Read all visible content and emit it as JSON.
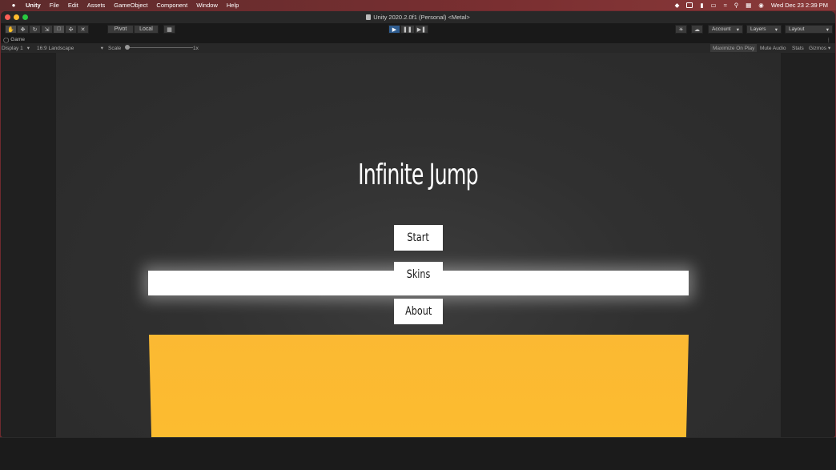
{
  "menubar": {
    "apple": "",
    "items": [
      "Unity",
      "File",
      "Edit",
      "Assets",
      "GameObject",
      "Component",
      "Window",
      "Help"
    ],
    "datetime": "Wed Dec 23  2:39 PM"
  },
  "window": {
    "title": "Unity 2020.2.0f1 (Personal) <Metal>"
  },
  "toolbar": {
    "pivot_label": "Pivot",
    "local_label": "Local",
    "account_label": "Account",
    "layers_label": "Layers",
    "layout_label": "Layout",
    "play_active": true
  },
  "game_view": {
    "tab_label": "Game",
    "display_label": "Display 1",
    "aspect_label": "16:9 Landscape",
    "scale_label": "Scale",
    "scale_value": "1x",
    "maximize_label": "Maximize On Play",
    "mute_label": "Mute Audio",
    "stats_label": "Stats",
    "gizmos_label": "Gizmos"
  },
  "game": {
    "title": "Infinite Jump",
    "buttons": [
      "Start",
      "Skins",
      "About"
    ]
  },
  "colors": {
    "lava": "#fbb933",
    "play_accent": "#2f5c8f"
  }
}
